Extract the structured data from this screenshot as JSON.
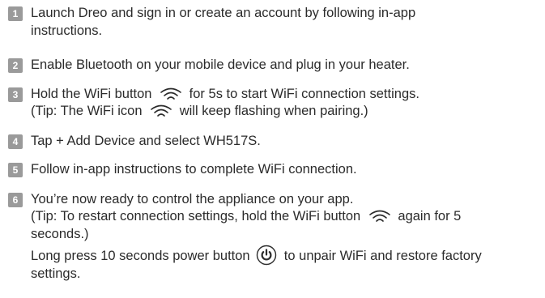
{
  "steps": [
    {
      "number": "1",
      "lines": [
        "Launch Dreo and sign in or create an account by following in-app",
        "instructions."
      ]
    },
    {
      "number": "2",
      "lines": [
        "Enable Bluetooth on your mobile device and plug in your heater."
      ]
    },
    {
      "number": "3",
      "line1_a": "Hold the WiFi button",
      "line1_b": "for 5s to start WiFi connection settings.",
      "line2_a": "(Tip: The WiFi icon",
      "line2_b": "will keep flashing when pairing.)"
    },
    {
      "number": "4",
      "lines": [
        "Tap + Add Device and select WH517S."
      ]
    },
    {
      "number": "5",
      "lines": [
        "Follow in-app instructions to complete WiFi connection."
      ]
    },
    {
      "number": "6",
      "line1": "You’re now ready to control the appliance on your app.",
      "line2_a": "(Tip: To restart connection settings, hold the WiFi button",
      "line2_b": "again for 5",
      "line3": "seconds.)",
      "line4_a": "Long press 10 seconds power button",
      "line4_b": "to unpair WiFi and restore factory",
      "line5": "settings."
    }
  ],
  "icons": {
    "wifi": "wifi-icon",
    "power": "power-icon",
    "badge_color": "#9a9a9a",
    "text_color": "#2b2b2b"
  }
}
